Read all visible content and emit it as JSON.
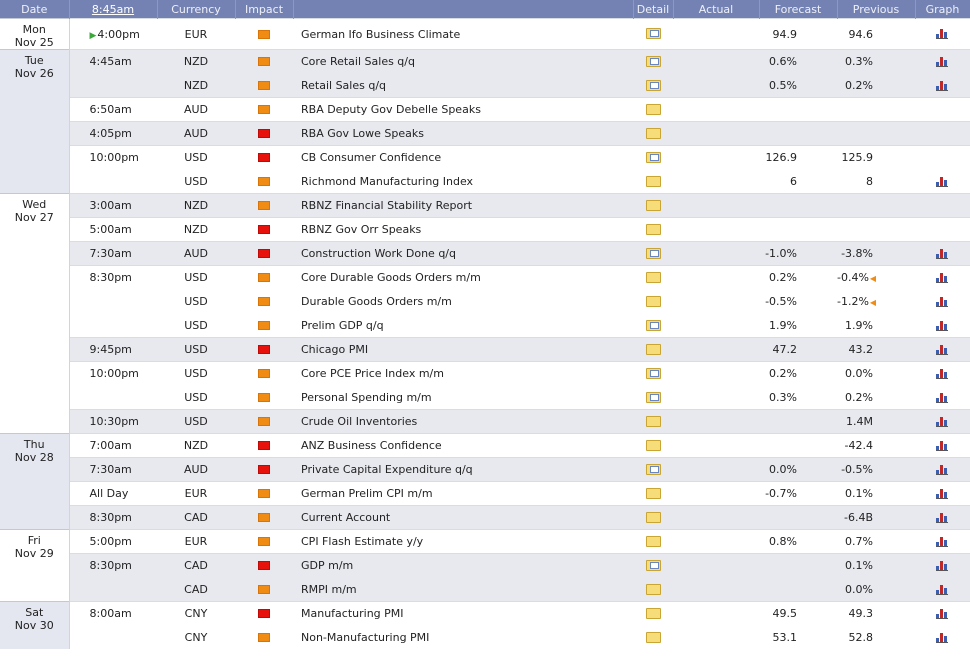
{
  "headers": {
    "date": "Date",
    "time": "8:45am",
    "currency": "Currency",
    "impact": "Impact",
    "event": "",
    "detail": "Detail",
    "actual": "Actual",
    "forecast": "Forecast",
    "previous": "Previous",
    "graph": "Graph"
  },
  "days": [
    {
      "day": "Mon",
      "date": "Nov 25",
      "rows": [
        {
          "time": "4:00pm",
          "current": true,
          "cur": "EUR",
          "impact": "medium",
          "event": "German Ifo Business Climate",
          "detail": "doc",
          "actual": "",
          "forecast": "94.9",
          "previous": "94.6",
          "graph": true
        }
      ]
    },
    {
      "day": "Tue",
      "date": "Nov 26",
      "rows": [
        {
          "time": "4:45am",
          "cur": "NZD",
          "impact": "medium",
          "event": "Core Retail Sales q/q",
          "detail": "doc",
          "actual": "",
          "forecast": "0.6%",
          "previous": "0.3%",
          "graph": true
        },
        {
          "time": "",
          "cur": "NZD",
          "impact": "medium",
          "event": "Retail Sales q/q",
          "detail": "doc",
          "actual": "",
          "forecast": "0.5%",
          "previous": "0.2%",
          "graph": true
        },
        {
          "time": "6:50am",
          "cur": "AUD",
          "impact": "medium",
          "event": "RBA Deputy Gov Debelle Speaks",
          "detail": "folder",
          "actual": "",
          "forecast": "",
          "previous": "",
          "graph": false
        },
        {
          "time": "4:05pm",
          "cur": "AUD",
          "impact": "high",
          "event": "RBA Gov Lowe Speaks",
          "detail": "folder",
          "actual": "",
          "forecast": "",
          "previous": "",
          "graph": false
        },
        {
          "time": "10:00pm",
          "cur": "USD",
          "impact": "high",
          "event": "CB Consumer Confidence",
          "detail": "doc",
          "actual": "",
          "forecast": "126.9",
          "previous": "125.9",
          "graph": false
        },
        {
          "time": "",
          "cur": "USD",
          "impact": "medium",
          "event": "Richmond Manufacturing Index",
          "detail": "folder",
          "actual": "",
          "forecast": "6",
          "previous": "8",
          "graph": true
        }
      ]
    },
    {
      "day": "Wed",
      "date": "Nov 27",
      "rows": [
        {
          "time": "3:00am",
          "cur": "NZD",
          "impact": "medium",
          "event": "RBNZ Financial Stability Report",
          "detail": "folder",
          "actual": "",
          "forecast": "",
          "previous": "",
          "graph": false
        },
        {
          "time": "5:00am",
          "cur": "NZD",
          "impact": "high",
          "event": "RBNZ Gov Orr Speaks",
          "detail": "folder",
          "actual": "",
          "forecast": "",
          "previous": "",
          "graph": false
        },
        {
          "time": "7:30am",
          "cur": "AUD",
          "impact": "high",
          "event": "Construction Work Done q/q",
          "detail": "doc",
          "actual": "",
          "forecast": "-1.0%",
          "previous": "-3.8%",
          "graph": true
        },
        {
          "time": "8:30pm",
          "cur": "USD",
          "impact": "medium",
          "event": "Core Durable Goods Orders m/m",
          "detail": "folder",
          "actual": "",
          "forecast": "0.2%",
          "previous": "-0.4%",
          "revised": true,
          "graph": true
        },
        {
          "time": "",
          "cur": "USD",
          "impact": "medium",
          "event": "Durable Goods Orders m/m",
          "detail": "folder",
          "actual": "",
          "forecast": "-0.5%",
          "previous": "-1.2%",
          "revised": true,
          "graph": true
        },
        {
          "time": "",
          "cur": "USD",
          "impact": "medium",
          "event": "Prelim GDP q/q",
          "detail": "doc",
          "actual": "",
          "forecast": "1.9%",
          "previous": "1.9%",
          "graph": true
        },
        {
          "time": "9:45pm",
          "cur": "USD",
          "impact": "high",
          "event": "Chicago PMI",
          "detail": "folder",
          "actual": "",
          "forecast": "47.2",
          "previous": "43.2",
          "graph": true
        },
        {
          "time": "10:00pm",
          "cur": "USD",
          "impact": "medium",
          "event": "Core PCE Price Index m/m",
          "detail": "doc",
          "actual": "",
          "forecast": "0.2%",
          "previous": "0.0%",
          "graph": true
        },
        {
          "time": "",
          "cur": "USD",
          "impact": "medium",
          "event": "Personal Spending m/m",
          "detail": "doc",
          "actual": "",
          "forecast": "0.3%",
          "previous": "0.2%",
          "graph": true
        },
        {
          "time": "10:30pm",
          "cur": "USD",
          "impact": "medium",
          "event": "Crude Oil Inventories",
          "detail": "folder",
          "actual": "",
          "forecast": "",
          "previous": "1.4M",
          "graph": true
        }
      ]
    },
    {
      "day": "Thu",
      "date": "Nov 28",
      "rows": [
        {
          "time": "7:00am",
          "cur": "NZD",
          "impact": "high",
          "event": "ANZ Business Confidence",
          "detail": "folder",
          "actual": "",
          "forecast": "",
          "previous": "-42.4",
          "graph": true
        },
        {
          "time": "7:30am",
          "cur": "AUD",
          "impact": "high",
          "event": "Private Capital Expenditure q/q",
          "detail": "doc",
          "actual": "",
          "forecast": "0.0%",
          "previous": "-0.5%",
          "graph": true
        },
        {
          "time": "All Day",
          "cur": "EUR",
          "impact": "medium",
          "event": "German Prelim CPI m/m",
          "detail": "folder",
          "actual": "",
          "forecast": "-0.7%",
          "previous": "0.1%",
          "graph": true
        },
        {
          "time": "8:30pm",
          "cur": "CAD",
          "impact": "medium",
          "event": "Current Account",
          "detail": "folder",
          "actual": "",
          "forecast": "",
          "previous": "-6.4B",
          "graph": true
        }
      ]
    },
    {
      "day": "Fri",
      "date": "Nov 29",
      "rows": [
        {
          "time": "5:00pm",
          "cur": "EUR",
          "impact": "medium",
          "event": "CPI Flash Estimate y/y",
          "detail": "folder",
          "actual": "",
          "forecast": "0.8%",
          "previous": "0.7%",
          "graph": true
        },
        {
          "time": "8:30pm",
          "cur": "CAD",
          "impact": "high",
          "event": "GDP m/m",
          "detail": "doc",
          "actual": "",
          "forecast": "",
          "previous": "0.1%",
          "graph": true
        },
        {
          "time": "",
          "cur": "CAD",
          "impact": "medium",
          "event": "RMPI m/m",
          "detail": "folder",
          "actual": "",
          "forecast": "",
          "previous": "0.0%",
          "graph": true
        }
      ]
    },
    {
      "day": "Sat",
      "date": "Nov 30",
      "rows": [
        {
          "time": "8:00am",
          "cur": "CNY",
          "impact": "high",
          "event": "Manufacturing PMI",
          "detail": "folder",
          "actual": "",
          "forecast": "49.5",
          "previous": "49.3",
          "graph": true
        },
        {
          "time": "",
          "cur": "CNY",
          "impact": "medium",
          "event": "Non-Manufacturing PMI",
          "detail": "folder",
          "actual": "",
          "forecast": "53.1",
          "previous": "52.8",
          "graph": true
        }
      ]
    }
  ],
  "colors": {
    "header_bg": "#7382b3",
    "impact_medium": "#f08c14",
    "impact_high": "#e8120c",
    "row_alt": "#e8e9ef",
    "date_col": "#e4e7f0"
  }
}
